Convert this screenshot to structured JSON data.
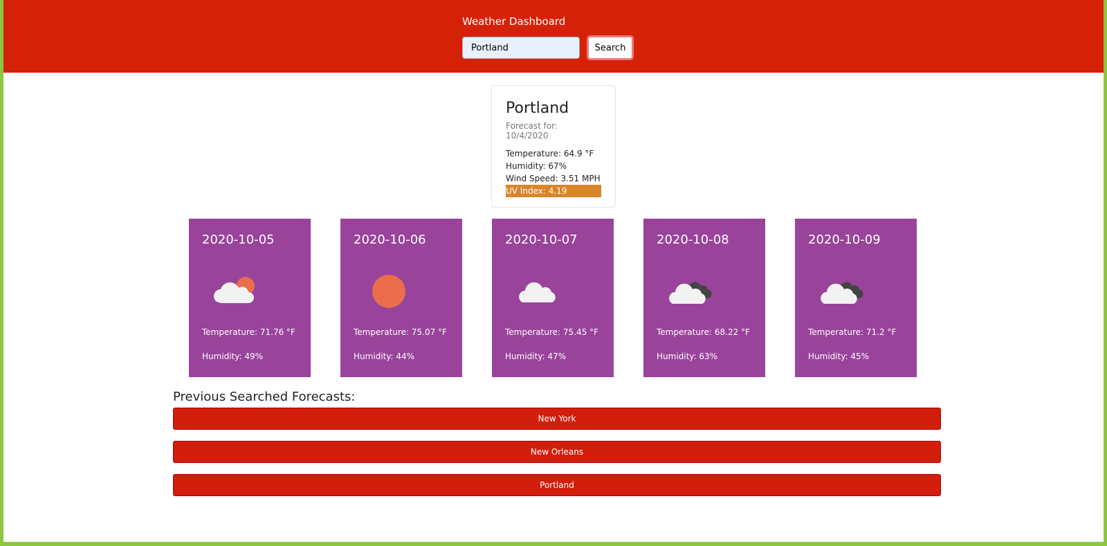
{
  "header": {
    "title": "Weather Dashboard",
    "search_value": "Portland",
    "search_label": "Search"
  },
  "current": {
    "city": "Portland",
    "forecast_for": "Forecast for: 10/4/2020",
    "temperature": "Temperature: 64.9 °F",
    "humidity": "Humidity: 67%",
    "wind": "Wind Speed: 3.51 MPH",
    "uv": "UV Index: 4.19",
    "uv_color": "#d9852a"
  },
  "forecast": [
    {
      "date": "2020-10-05",
      "icon": "partly-cloudy-icon",
      "temp": "Temperature: 71.76 °F",
      "humidity": "Humidity: 49%"
    },
    {
      "date": "2020-10-06",
      "icon": "sun-icon",
      "temp": "Temperature: 75.07 °F",
      "humidity": "Humidity: 44%"
    },
    {
      "date": "2020-10-07",
      "icon": "cloud-icon",
      "temp": "Temperature: 75.45 °F",
      "humidity": "Humidity: 47%"
    },
    {
      "date": "2020-10-08",
      "icon": "broken-clouds-icon",
      "temp": "Temperature: 68.22 °F",
      "humidity": "Humidity: 63%"
    },
    {
      "date": "2020-10-09",
      "icon": "broken-clouds-icon",
      "temp": "Temperature: 71.2 °F",
      "humidity": "Humidity: 45%"
    }
  ],
  "previous": {
    "title": "Previous Searched Forecasts:",
    "items": [
      "New York",
      "New Orleans",
      "Portland"
    ]
  }
}
